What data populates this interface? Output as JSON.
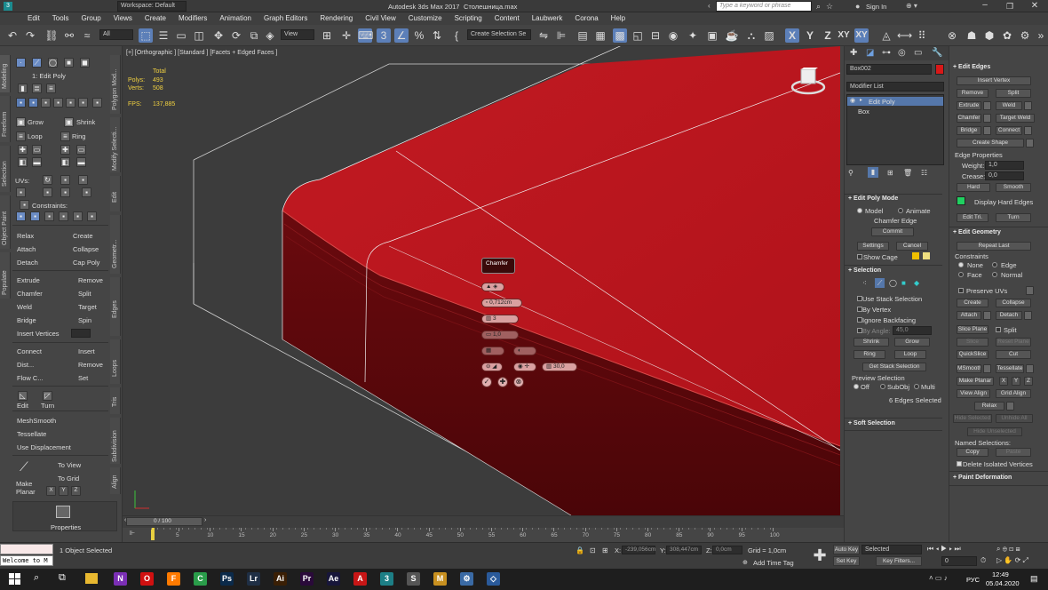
{
  "title": {
    "workspace": "Workspace: Default",
    "app_title": "Autodesk 3ds Max 2017",
    "file_name": "Столешница.max",
    "search_placeholder": "Type a keyword or phrase",
    "sign_in": "Sign In"
  },
  "menu": [
    "Edit",
    "Tools",
    "Group",
    "Views",
    "Create",
    "Modifiers",
    "Animation",
    "Graph Editors",
    "Rendering",
    "Civil View",
    "Customize",
    "Scripting",
    "Content",
    "Laubwerk",
    "Corona",
    "Help"
  ],
  "toolbar": {
    "filter_value": "All",
    "view_value": "View",
    "selection_set": "Create Selection Se",
    "axis_labels": [
      "X",
      "Y",
      "Z",
      "XY",
      "XY"
    ]
  },
  "ribbon": {
    "vertical_tabs": [
      "Modeling",
      "Freeform",
      "Selection",
      "Object Paint",
      "Populate"
    ],
    "section_tabs": [
      "Polygon Mod...",
      "Modify Selecti...",
      "Edit",
      "Geometr...",
      "Edges",
      "Loops",
      "Tris",
      "Subdivision",
      "Align"
    ],
    "mode_label": "1: Edit Poly",
    "grow": "Grow",
    "shrink": "Shrink",
    "loop": "Loop",
    "ring": "Ring",
    "uvs": "UVs:",
    "constraints": "Constraints:",
    "relax": "Relax",
    "create": "Create",
    "attach": "Attach",
    "collapse": "Collapse",
    "detach": "Detach",
    "cap_poly": "Cap Poly",
    "extrude": "Extrude",
    "remove": "Remove",
    "chamfer": "Chamfer",
    "split": "Split",
    "weld": "Weld",
    "target": "Target",
    "bridge": "Bridge",
    "spin": "Spin",
    "insert_vertices": "Insert Vertices",
    "connect": "Connect",
    "insert": "Insert",
    "dist": "Dist...",
    "remove2": "Remove",
    "flow": "Flow C...",
    "set": "Set",
    "edit": "Edit",
    "turn": "Turn",
    "meshsmooth": "MeshSmooth",
    "tessellate": "Tessellate",
    "use_displacement": "Use Displacement",
    "to_view": "To View",
    "to_grid": "To Grid",
    "make_planar": "Make Planar",
    "xyz": [
      "X",
      "Y",
      "Z"
    ],
    "properties": "Properties"
  },
  "viewport": {
    "label": "[+] [Orthographic ] [Standard ] [Facets + Edged Faces ]",
    "stats_total": "Total",
    "polys_label": "Polys:",
    "polys_value": "493",
    "verts_label": "Verts:",
    "verts_value": "508",
    "fps_label": "FPS:",
    "fps_value": "137,885",
    "object_color": "#c8141c",
    "caddy": {
      "title": "Chamfer",
      "amount": "0,712cm",
      "segments": "3",
      "tension": "1,0",
      "angle": "30,0"
    }
  },
  "command_panel": {
    "object_name": "Box002",
    "modifier_list": "Modifier List",
    "stack": [
      "Edit Poly",
      "Box"
    ],
    "edit_poly_mode": "Edit Poly Mode",
    "model": "Model",
    "animate": "Animate",
    "chamfer_edge": "Chamfer Edge",
    "commit": "Commit",
    "settings": "Settings",
    "cancel": "Cancel",
    "show_cage": "Show Cage",
    "selection": "Selection",
    "use_stack_selection": "Use Stack Selection",
    "by_vertex": "By Vertex",
    "ignore_backfacing": "Ignore Backfacing",
    "by_angle": "By Angle:",
    "by_angle_value": "45,0",
    "shrink": "Shrink",
    "grow": "Grow",
    "ring": "Ring",
    "loop": "Loop",
    "get_stack_selection": "Get Stack Selection",
    "preview_selection": "Preview Selection",
    "off": "Off",
    "subobj": "SubObj",
    "multi": "Multi",
    "edges_selected": "6 Edges Selected",
    "soft_selection": "Soft Selection",
    "swatch_color": "#d81818"
  },
  "edit_panel": {
    "edit_edges": "Edit Edges",
    "insert_vertex": "Insert Vertex",
    "remove": "Remove",
    "split": "Split",
    "extrude": "Extrude",
    "weld": "Weld",
    "chamfer": "Chamfer",
    "target_weld": "Target Weld",
    "bridge": "Bridge",
    "connect": "Connect",
    "create_shape": "Create Shape",
    "edge_properties": "Edge Properties",
    "weight_label": "Weight:",
    "weight_value": "1,0",
    "crease_label": "Crease:",
    "crease_value": "0,0",
    "hard": "Hard",
    "smooth": "Smooth",
    "display_hard_edges": "Display Hard Edges",
    "edit_tri": "Edit Tri.",
    "turn": "Turn",
    "edit_geometry": "Edit Geometry",
    "repeat_last": "Repeat Last",
    "constraints": "Constraints",
    "none": "None",
    "edge": "Edge",
    "face": "Face",
    "normal": "Normal",
    "preserve_uvs": "Preserve UVs",
    "create": "Create",
    "collapse": "Collapse",
    "attach": "Attach",
    "detach": "Detach",
    "slice_plane": "Slice Plane",
    "slice": "Slice",
    "reset_plane": "Reset Plane",
    "quickslice": "QuickSlice",
    "cut": "Cut",
    "msmooth": "MSmooth",
    "tessellate": "Tessellate",
    "make_planar": "Make Planar",
    "x": "X",
    "y": "Y",
    "z": "Z",
    "view_align": "View Align",
    "grid_align": "Grid Align",
    "relax": "Relax",
    "hide_selected": "Hide Selected",
    "unhide_all": "Unhide All",
    "hide_unselected": "Hide Unselected",
    "named_selections": "Named Selections:",
    "copy": "Copy",
    "paste": "Paste",
    "delete_isolated": "Delete Isolated Vertices",
    "paint_deformation": "Paint Deformation",
    "hard_edge_color": "#20d060"
  },
  "timeline": {
    "frame_counter": "0 / 100",
    "ticks": [
      "5",
      "10",
      "15",
      "20",
      "25",
      "30",
      "35",
      "40",
      "45",
      "50",
      "55",
      "60",
      "65",
      "70",
      "75",
      "80",
      "85",
      "90",
      "95",
      "100"
    ]
  },
  "status": {
    "maxscript": "Welcome to M",
    "selected": "1 Object Selected",
    "x_label": "X:",
    "x_value": "-239,056cm",
    "y_label": "Y:",
    "y_value": "308,447cm",
    "z_label": "Z:",
    "z_value": "0,0cm",
    "grid": "Grid = 1,0cm",
    "add_time_tag": "Add Time Tag",
    "auto_key": "Auto Key",
    "selected_dropdown": "Selected",
    "set_key": "Set Key",
    "key_filters": "Key Filters...",
    "frame": "0"
  },
  "taskbar": {
    "time": "12:49",
    "date": "05.04.2020",
    "lang": "РУС",
    "apps": [
      {
        "t": "N",
        "c": "#7b2fb5"
      },
      {
        "t": "O",
        "c": "#d01010"
      },
      {
        "t": "F",
        "c": "#ff7a00"
      },
      {
        "t": "C",
        "c": "#2a9d4a"
      },
      {
        "t": "Ps",
        "c": "#0b2a4a"
      },
      {
        "t": "Lr",
        "c": "#1f2f45"
      },
      {
        "t": "Ai",
        "c": "#3a1f05"
      },
      {
        "t": "Pr",
        "c": "#2a0a3a"
      },
      {
        "t": "Ae",
        "c": "#17163a"
      },
      {
        "t": "A",
        "c": "#c81616"
      },
      {
        "t": "3",
        "c": "#1d7f86"
      },
      {
        "t": "S",
        "c": "#555"
      },
      {
        "t": "M",
        "c": "#c89020"
      },
      {
        "t": "⚙",
        "c": "#3a6aa5"
      },
      {
        "t": "◇",
        "c": "#2a5a9a"
      }
    ]
  }
}
